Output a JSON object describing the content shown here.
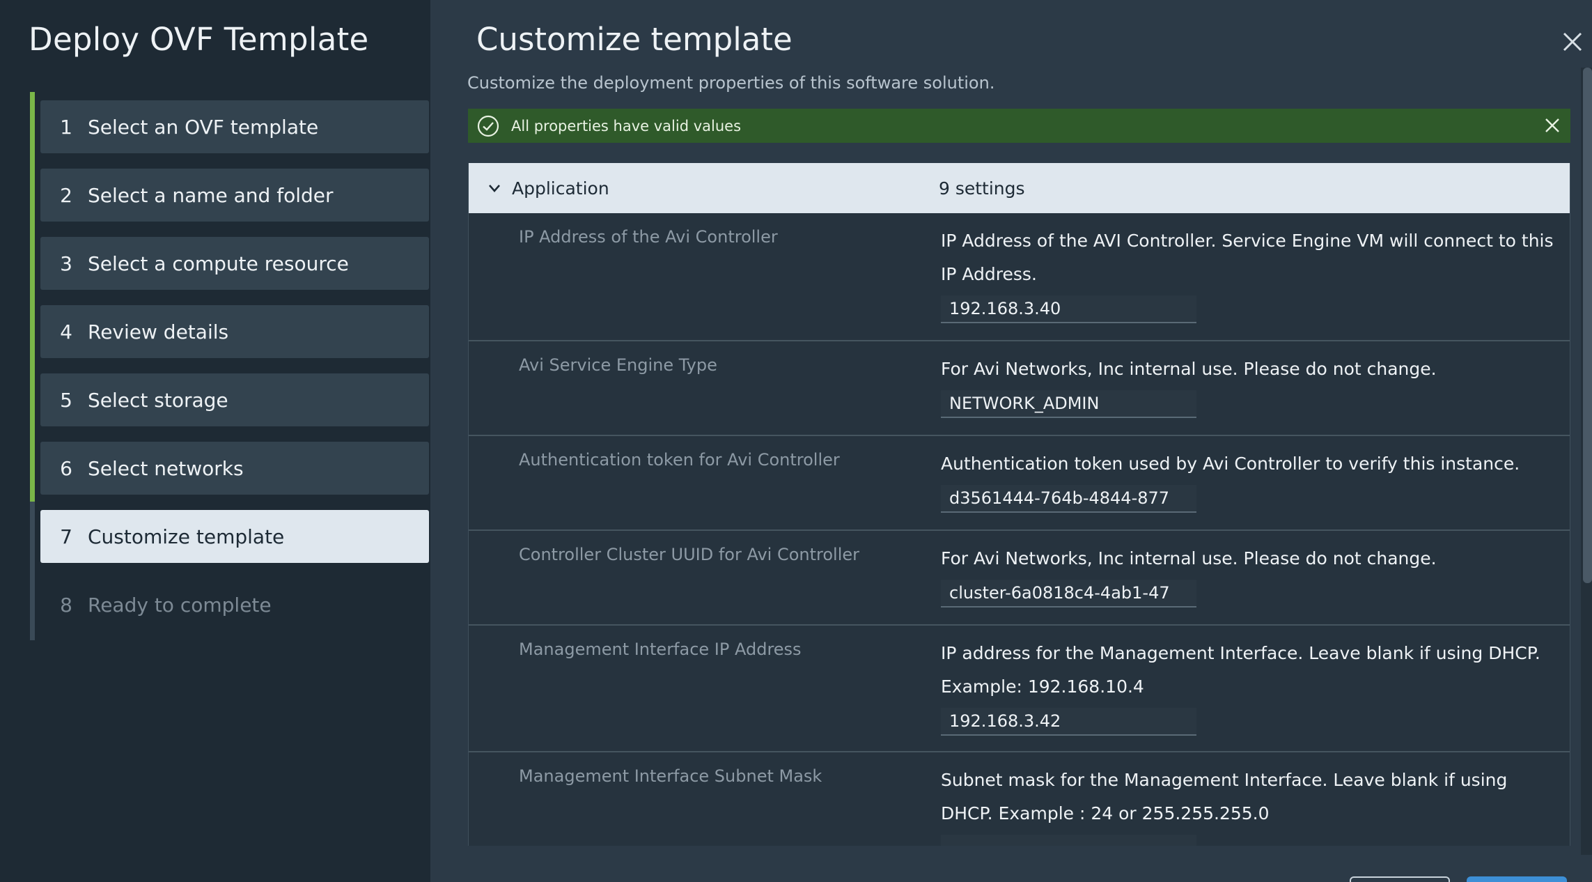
{
  "wizard": {
    "title": "Deploy OVF Template",
    "steps": [
      {
        "num": "1",
        "label": "Select an OVF template"
      },
      {
        "num": "2",
        "label": "Select a name and folder"
      },
      {
        "num": "3",
        "label": "Select a compute resource"
      },
      {
        "num": "4",
        "label": "Review details"
      },
      {
        "num": "5",
        "label": "Select storage"
      },
      {
        "num": "6",
        "label": "Select networks"
      },
      {
        "num": "7",
        "label": "Customize template"
      },
      {
        "num": "8",
        "label": "Ready to complete"
      }
    ],
    "active_step": 7
  },
  "main": {
    "title": "Customize template",
    "subtitle": "Customize the deployment properties of this software solution.",
    "alert": "All properties have valid values",
    "group": {
      "name": "Application",
      "count": "9 settings"
    },
    "rows": [
      {
        "label": "IP Address of the Avi Controller",
        "description": "IP Address of the AVI Controller. Service Engine VM will connect to this IP Address.",
        "value": "192.168.3.40"
      },
      {
        "label": "Avi Service Engine Type",
        "description": "For Avi Networks, Inc internal use. Please do not change.",
        "value": "NETWORK_ADMIN"
      },
      {
        "label": "Authentication token for Avi Controller",
        "description": "Authentication token used by Avi Controller to verify this instance.",
        "value": "d3561444-764b-4844-877"
      },
      {
        "label": "Controller Cluster UUID for Avi Controller",
        "description": "For Avi Networks, Inc internal use. Please do not change.",
        "value": "cluster-6a0818c4-4ab1-47"
      },
      {
        "label": "Management Interface IP Address",
        "description": "IP address for the Management Interface. Leave blank if using DHCP. Example: 192.168.10.4",
        "value": "192.168.3.42"
      },
      {
        "label": "Management Interface Subnet Mask",
        "description": "Subnet mask for the Management Interface. Leave blank if using DHCP. Example : 24 or 255.255.255.0",
        "value": ""
      }
    ]
  },
  "colors": {
    "accent_green": "#7ab648",
    "alert_bg": "#2f5a2a",
    "active_step_bg": "#dfe7ee",
    "primary_button": "#3d8fd6"
  }
}
